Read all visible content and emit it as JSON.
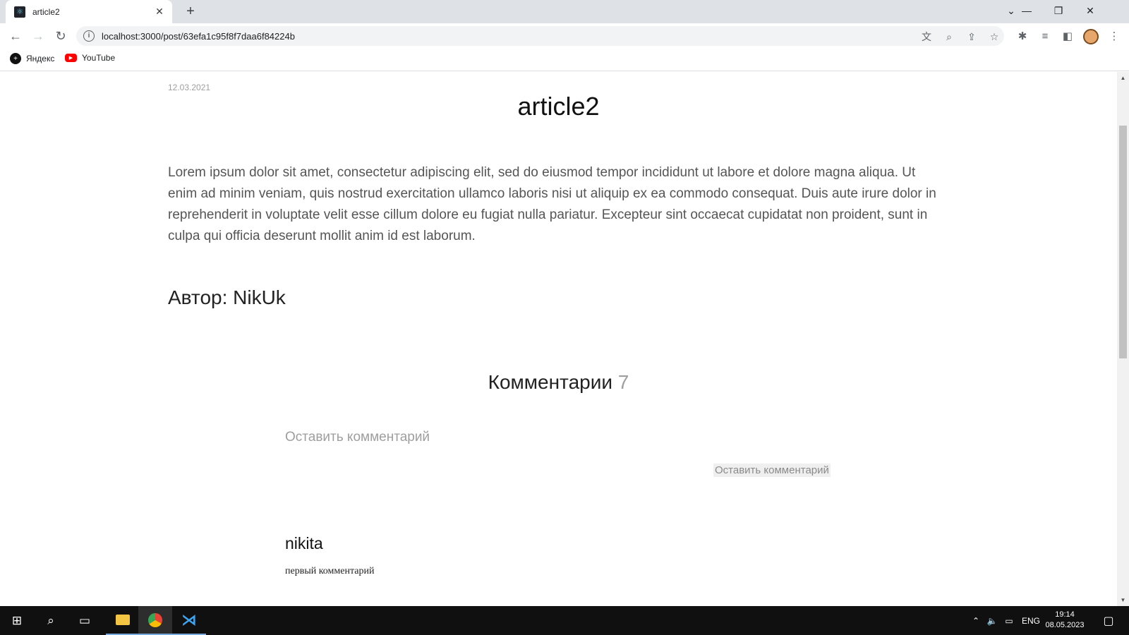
{
  "browser": {
    "tab_title": "article2",
    "url": "localhost:3000/post/63efa1c95f8f7daa6f84224b",
    "bookmarks": [
      {
        "label": "Яндекс",
        "icon": "yandex-icon"
      },
      {
        "label": "YouTube",
        "icon": "youtube-icon"
      }
    ]
  },
  "post": {
    "date": "12.03.2021",
    "title": "article2",
    "body": "Lorem ipsum dolor sit amet, consectetur adipiscing elit, sed do eiusmod tempor incididunt ut labore et dolore magna aliqua. Ut enim ad minim veniam, quis nostrud exercitation ullamco laboris nisi ut aliquip ex ea commodo consequat. Duis aute irure dolor in reprehenderit in voluptate velit esse cillum dolore eu fugiat nulla pariatur. Excepteur sint occaecat cupidatat non proident, sunt in culpa qui officia deserunt mollit anim id est laborum.",
    "author": "Автор: NikUk"
  },
  "comments": {
    "heading": "Комментарии",
    "count": "7",
    "input_placeholder": "Оставить комментарий",
    "submit_label": "Оставить комментарий",
    "items": [
      {
        "author": "nikita",
        "text": "первый комментарий"
      }
    ]
  },
  "taskbar": {
    "language": "ENG",
    "time": "19:14",
    "date": "08.05.2023"
  },
  "colors": {
    "chrome_tab_bg": "#dee1e6",
    "taskbar_bg": "#101010",
    "muted_text": "#9e9e9e"
  }
}
